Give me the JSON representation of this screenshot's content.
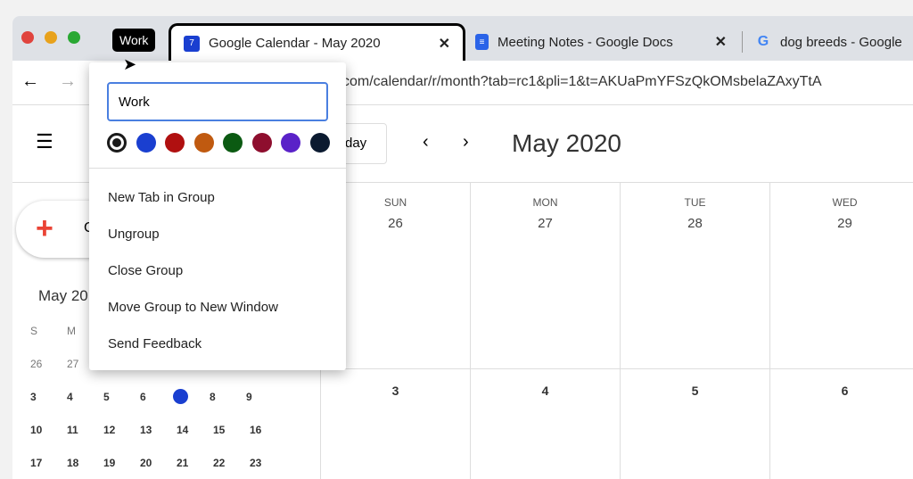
{
  "tabs": {
    "group_label": "Work",
    "items": [
      {
        "title": "Google Calendar - May 2020",
        "favicon": "calendar-icon",
        "favicon_text": "7"
      },
      {
        "title": "Meeting Notes - Google Docs",
        "favicon": "docs-icon"
      },
      {
        "title": "dog breeds - Google",
        "favicon": "google-icon",
        "favicon_text": "G"
      }
    ]
  },
  "toolbar": {
    "url": "com/calendar/r/month?tab=rc1&pli=1&t=AKUaPmYFSzQkOMsbelaZAxyTtA"
  },
  "calendar": {
    "today_button": "day",
    "month_title": "May 2020",
    "create_label": "C",
    "columns": [
      {
        "dow": "SUN",
        "d1": "26",
        "d2": "3"
      },
      {
        "dow": "MON",
        "d1": "27",
        "d2": "4"
      },
      {
        "dow": "TUE",
        "d1": "28",
        "d2": "5"
      },
      {
        "dow": "WED",
        "d1": "29",
        "d2": "6"
      }
    ],
    "mini": {
      "title": "May 20",
      "dows": [
        "S",
        "M"
      ],
      "row0": [
        "26",
        "27"
      ],
      "rows": [
        [
          "3",
          "4",
          "5",
          "6",
          "7",
          "8",
          "9"
        ],
        [
          "10",
          "11",
          "12",
          "13",
          "14",
          "15",
          "16"
        ],
        [
          "17",
          "18",
          "19",
          "20",
          "21",
          "22",
          "23"
        ]
      ],
      "today": "7"
    }
  },
  "popup": {
    "name_value": "Work",
    "colors": [
      "#1a1a1a",
      "#1a3fd0",
      "#b01010",
      "#c05a10",
      "#0b5a12",
      "#8e0e2e",
      "#5a22c8",
      "#0b1a30"
    ],
    "menu": [
      "New Tab in Group",
      "Ungroup",
      "Close Group",
      "Move Group to New Window",
      "Send Feedback"
    ]
  }
}
